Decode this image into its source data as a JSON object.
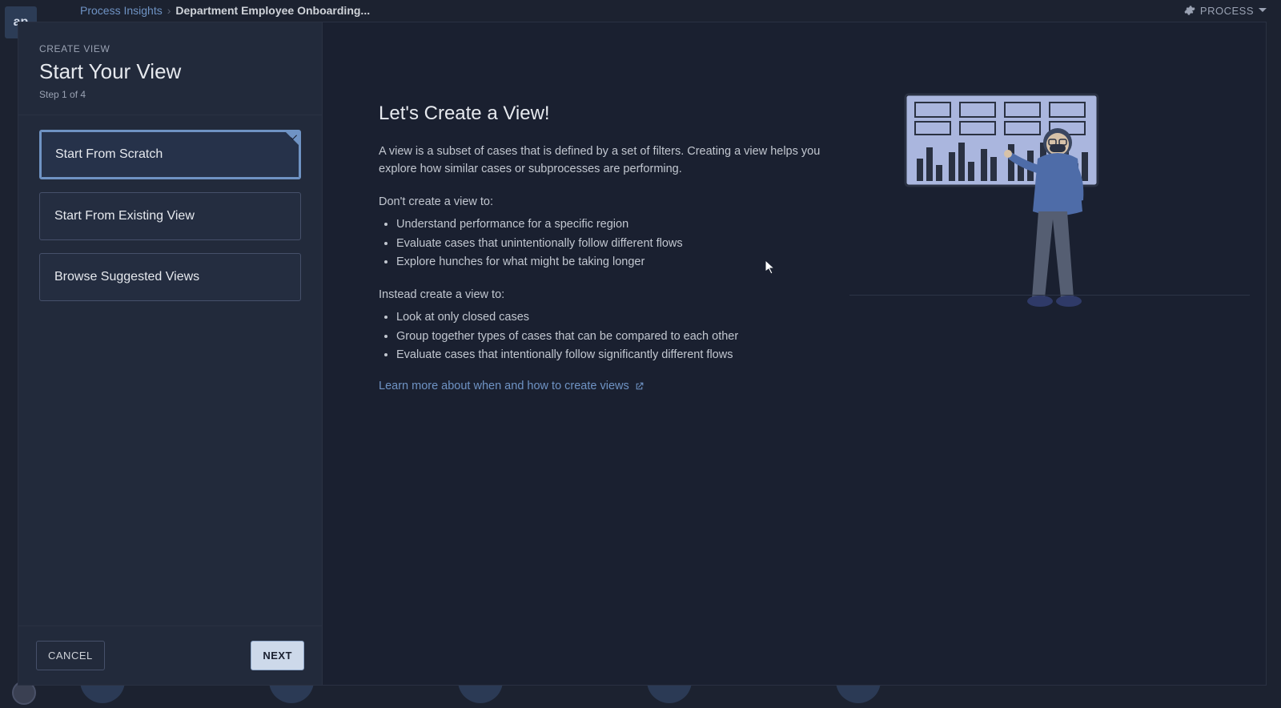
{
  "brand_text": "ap",
  "breadcrumb": {
    "root": "Process Insights",
    "current": "Department Employee Onboarding..."
  },
  "header_menu": {
    "label": "PROCESS"
  },
  "left_panel": {
    "eyebrow": "CREATE VIEW",
    "title": "Start Your View",
    "step_label": "Step 1 of 4",
    "options": [
      "Start From Scratch",
      "Start From Existing View",
      "Browse Suggested Views"
    ],
    "selected_index": 0,
    "cancel_label": "CANCEL",
    "next_label": "NEXT"
  },
  "right_panel": {
    "heading": "Let's Create a View!",
    "intro": "A view is a subset of cases that is defined by a set of filters. Creating a view helps you explore how similar cases or subprocesses are performing.",
    "dont_label": "Don't create a view to:",
    "dont_items": [
      "Understand performance for a specific region",
      "Evaluate cases that unintentionally follow different flows",
      "Explore hunches for what might be taking longer"
    ],
    "instead_label": "Instead create a view to:",
    "instead_items": [
      "Look at only closed cases",
      "Group together types of cases that can be compared to each other",
      "Evaluate cases that intentionally follow significantly different flows"
    ],
    "learn_more": "Learn more about when and how to create views"
  }
}
